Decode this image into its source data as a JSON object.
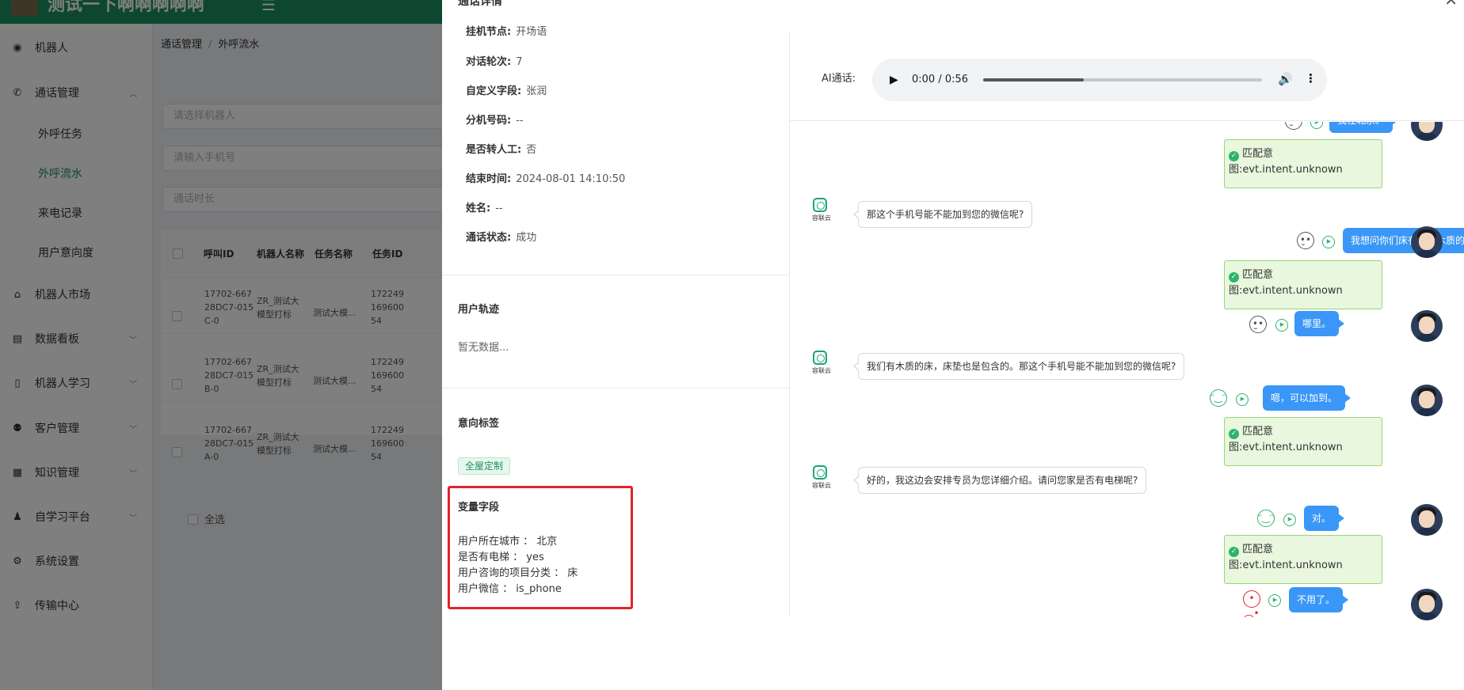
{
  "app": {
    "brand": "测试一下啊啊啊啊啊",
    "accent_color": "#1a8e5f"
  },
  "sidebar": {
    "items": [
      {
        "label": "机器人",
        "icon": "robot-icon"
      },
      {
        "label": "通话管理",
        "icon": "phone-icon",
        "expanded": true
      },
      {
        "label": "机器人市场",
        "icon": "home-icon"
      },
      {
        "label": "数据看板",
        "icon": "chart-icon"
      },
      {
        "label": "机器人学习",
        "icon": "book-icon"
      },
      {
        "label": "客户管理",
        "icon": "users-icon"
      },
      {
        "label": "知识管理",
        "icon": "knowledge-icon"
      },
      {
        "label": "自学习平台",
        "icon": "learning-icon"
      },
      {
        "label": "系统设置",
        "icon": "settings-icon"
      },
      {
        "label": "传输中心",
        "icon": "upload-icon"
      }
    ],
    "sub_items": [
      {
        "label": "外呼任务",
        "active": false
      },
      {
        "label": "外呼流水",
        "active": true
      },
      {
        "label": "来电记录",
        "active": false
      },
      {
        "label": "用户意向度",
        "active": false
      }
    ]
  },
  "breadcrumb": [
    "通话管理",
    "外呼流水"
  ],
  "filters": {
    "robot_placeholder": "请选择机器人",
    "phone_placeholder": "请输入手机号",
    "duration_placeholder": "通话时长"
  },
  "table": {
    "headers": [
      "呼叫ID",
      "机器人名称",
      "任务名称",
      "任务ID"
    ],
    "rows": [
      {
        "call_id": [
          "17702-667",
          "28DC7-015",
          "C-0"
        ],
        "robot": [
          "ZR_测试大",
          "模型打标"
        ],
        "task": "测试大模...",
        "task_id": [
          "172249",
          "169600",
          "54"
        ]
      },
      {
        "call_id": [
          "17702-667",
          "28DC7-015",
          "B-0"
        ],
        "robot": [
          "ZR_测试大",
          "模型打标"
        ],
        "task": "测试大模...",
        "task_id": [
          "172249",
          "169600",
          "54"
        ]
      },
      {
        "call_id": [
          "17702-667",
          "28DC7-015",
          "A-0"
        ],
        "robot": [
          "ZR_测试大",
          "模型打标"
        ],
        "task": "测试大模...",
        "task_id": [
          "172249",
          "169600",
          "54"
        ]
      }
    ],
    "select_all": "全选"
  },
  "drawer": {
    "title": "通话详情",
    "info": [
      {
        "key": "挂机节点:",
        "value": "开场语"
      },
      {
        "key": "对话轮次:",
        "value": "7"
      },
      {
        "key": "自定义字段:",
        "value": "张润"
      },
      {
        "key": "分机号码:",
        "value": "--"
      },
      {
        "key": "是否转人工:",
        "value": "否"
      },
      {
        "key": "结束时间:",
        "value": "2024-08-01 14:10:50"
      },
      {
        "key": "姓名:",
        "value": "--"
      },
      {
        "key": "通话状态:",
        "value": "成功"
      }
    ],
    "user_track": {
      "title": "用户轨迹",
      "empty": "暂无数据..."
    },
    "intent_tags": {
      "title": "意向标签",
      "tag": "全屋定制"
    },
    "variables": {
      "title": "变量字段",
      "rows": [
        "用户所在城市 ：  北京",
        "是否有电梯 ：  yes",
        "用户咨询的项目分类 ：  床",
        "用户微信 ：  is_phone"
      ]
    },
    "audio": {
      "label": "AI通话:",
      "time": "0:00 / 0:56",
      "progress_fraction": 0.36
    },
    "chat": {
      "bot_name": "容联云",
      "match_title": "匹配意",
      "match_detail": "图:evt.intent.unknown",
      "messages": [
        {
          "type": "user",
          "text": "我在北京。",
          "emotion": "neutral"
        },
        {
          "type": "bot",
          "text": "那这个手机号能不能加到您的微信呢?"
        },
        {
          "type": "user",
          "text": "我想问你们床有没有木质的床？另外床垫包不包?",
          "emotion": "neutral"
        },
        {
          "type": "user",
          "text": "哪里。",
          "emotion": "neutral"
        },
        {
          "type": "bot",
          "text": "我们有木质的床，床垫也是包含的。那这个手机号能不能加到您的微信呢?"
        },
        {
          "type": "user",
          "text": "嗯，可以加到。",
          "emotion": "positive"
        },
        {
          "type": "bot",
          "text": "好的，我这边会安排专员为您详细介绍。请问您家是否有电梯呢?"
        },
        {
          "type": "user",
          "text": "对。",
          "emotion": "positive"
        },
        {
          "type": "user",
          "text": "不用了。",
          "emotion": "negative"
        }
      ]
    }
  }
}
